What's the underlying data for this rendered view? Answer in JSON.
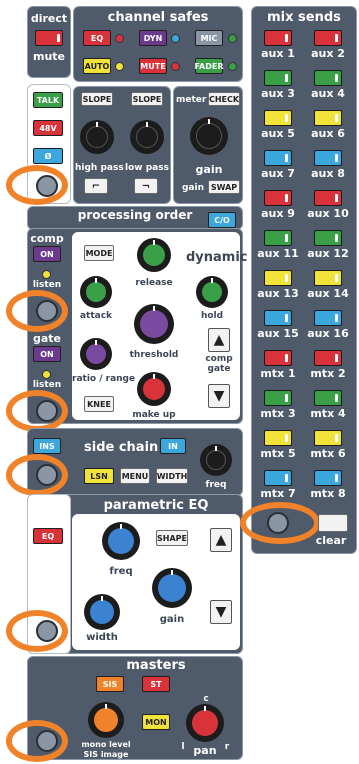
{
  "left": {
    "direct_label": "direct",
    "mute_label": "mute",
    "talk": "TALK",
    "v48": "48V",
    "phase": "Ø"
  },
  "channel_safes": {
    "title": "channel safes",
    "buttons": [
      "EQ",
      "DYN",
      "MIC",
      "AUTO",
      "MUTE",
      "FADER"
    ]
  },
  "preamp": {
    "slope1": "SLOPE",
    "slope2": "SLOPE",
    "high_pass": "high pass",
    "low_pass": "low pass",
    "meter": "meter",
    "check": "CHECK",
    "gain": "gain",
    "gain_swap_label": "gain",
    "swap": "SWAP"
  },
  "processing_order": {
    "title": "processing order",
    "co": "C/O"
  },
  "dynamics": {
    "comp": "comp",
    "comp_on": "ON",
    "listen1": "listen",
    "gate": "gate",
    "gate_on": "ON",
    "listen2": "listen",
    "mode": "MODE",
    "dynamic": "dynamic",
    "release": "release",
    "attack": "attack",
    "hold": "hold",
    "threshold": "threshold",
    "comp_gate": "comp\ngate",
    "ratio": "ratio / range",
    "knee": "KNEE",
    "make_up": "make up"
  },
  "side_chain": {
    "ins": "INS",
    "title": "side chain",
    "in": "IN",
    "lsn": "LSN",
    "menu": "MENU",
    "width": "WIDTH",
    "freq": "freq"
  },
  "eq": {
    "eq_btn": "EQ",
    "title": "parametric EQ",
    "shape": "SHAPE",
    "freq": "freq",
    "gain": "gain",
    "width": "width"
  },
  "masters": {
    "title": "masters",
    "sis": "SIS",
    "st": "ST",
    "mon": "MON",
    "mono": "mono level",
    "sis_image": "SIS image",
    "pan": "pan",
    "c": "c",
    "l": "l",
    "r": "r"
  },
  "mix_sends": {
    "title": "mix sends",
    "groups": [
      {
        "labels": [
          "aux 1",
          "aux 2",
          "aux 3",
          "aux 4",
          "aux 5",
          "aux 6",
          "aux 7",
          "aux 8"
        ]
      },
      {
        "labels": [
          "aux 9",
          "aux 10",
          "aux 11",
          "aux 12",
          "aux 13",
          "aux 14",
          "aux 15",
          "aux 16"
        ]
      },
      {
        "labels": [
          "mtx 1",
          "mtx 2",
          "mtx 3",
          "mtx 4",
          "mtx 5",
          "mtx 6",
          "mtx 7",
          "mtx 8"
        ]
      }
    ],
    "clear": "clear"
  },
  "colors": {
    "panel": "#4f5a6a",
    "red": "#d8333a",
    "green": "#3aa048",
    "yellow": "#f2e33a",
    "blue": "#3ba7dc",
    "purple": "#6c3a8c",
    "highlight": "#f0822a"
  }
}
